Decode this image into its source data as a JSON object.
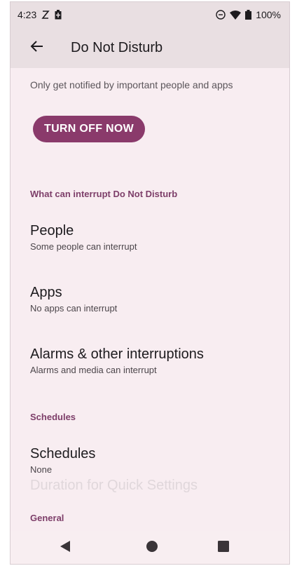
{
  "status_bar": {
    "time": "4:23",
    "icons_left": [
      "sync-icon",
      "battery-saver-icon"
    ],
    "icons_right": [
      "dnd-icon",
      "wifi-icon",
      "battery-icon"
    ],
    "battery": "100%"
  },
  "toolbar": {
    "back_icon": "arrow-left-icon",
    "title": "Do Not Disturb"
  },
  "summary": "Only get notified by important people and apps",
  "turn_off_label": "TURN OFF NOW",
  "sections": {
    "interrupt_header": "What can interrupt Do Not Disturb",
    "schedules_header": "Schedules",
    "general_header": "General"
  },
  "prefs": {
    "people": {
      "title": "People",
      "summary": "Some people can interrupt"
    },
    "apps": {
      "title": "Apps",
      "summary": "No apps can interrupt"
    },
    "alarms": {
      "title": "Alarms & other interruptions",
      "summary": "Alarms and media can interrupt"
    },
    "schedules": {
      "title": "Schedules",
      "summary": "None"
    }
  },
  "partially_hidden": "Duration for Quick Settings",
  "nav": [
    "back-triangle-icon",
    "home-circle-icon",
    "recents-square-icon"
  ],
  "colors": {
    "accent": "#8a3a6b",
    "section_header": "#7d3e69",
    "background": "#f8edf1",
    "bars": "#e9dfe2"
  }
}
